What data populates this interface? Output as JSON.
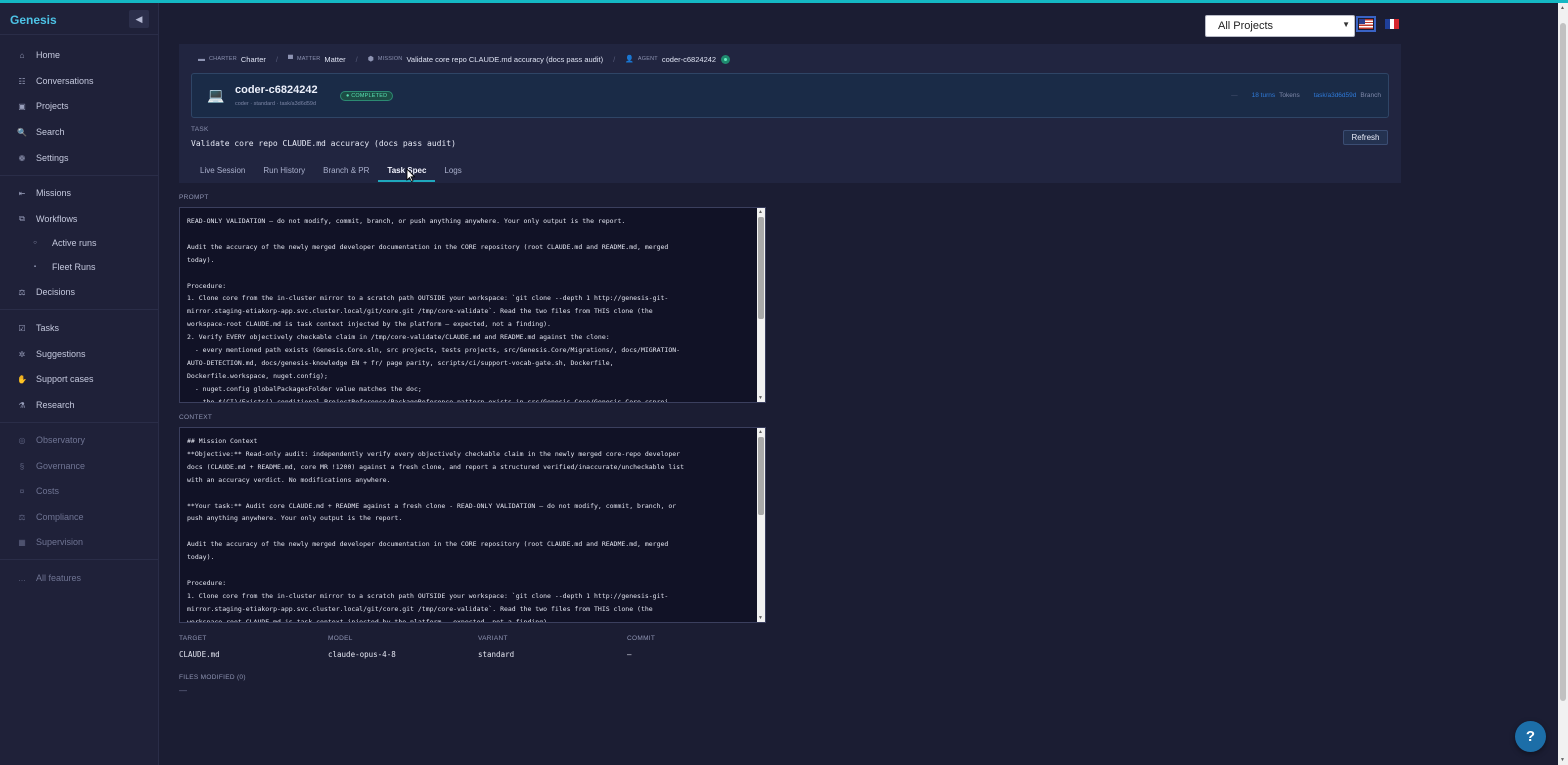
{
  "app": {
    "brand": "Genesis",
    "collapse_icon": "◀"
  },
  "sidebar": {
    "primary": [
      {
        "label": "Home",
        "icon": "⌂"
      },
      {
        "label": "Conversations",
        "icon": "☷"
      },
      {
        "label": "Projects",
        "icon": "▣"
      },
      {
        "label": "Search",
        "icon": "🔍"
      },
      {
        "label": "Settings",
        "icon": "❁"
      }
    ],
    "work": [
      {
        "label": "Missions",
        "icon": "⇤"
      },
      {
        "label": "Workflows",
        "icon": "⧉"
      },
      {
        "label": "Active runs",
        "icon": "○"
      },
      {
        "label": "Fleet Runs",
        "icon": "▪"
      },
      {
        "label": "Decisions",
        "icon": "⚖"
      }
    ],
    "ops": [
      {
        "label": "Tasks",
        "icon": "☑"
      },
      {
        "label": "Suggestions",
        "icon": "✲"
      },
      {
        "label": "Support cases",
        "icon": "✋"
      },
      {
        "label": "Research",
        "icon": "⚗"
      }
    ],
    "gov": [
      {
        "label": "Observatory",
        "icon": "◎"
      },
      {
        "label": "Governance",
        "icon": "§"
      },
      {
        "label": "Costs",
        "icon": "¤"
      },
      {
        "label": "Compliance",
        "icon": "⚖"
      },
      {
        "label": "Supervision",
        "icon": "▦"
      }
    ],
    "all_features": {
      "label": "All features",
      "icon": "…"
    }
  },
  "header": {
    "project_select": "All Projects",
    "flags": [
      "us-flag",
      "fr-flag"
    ],
    "fr_colors": [
      "#1f3f99",
      "#ffffff",
      "#d6262e"
    ]
  },
  "breadcrumb": [
    {
      "icon": "▬",
      "tag": "CHARTER",
      "value": "Charter"
    },
    {
      "icon": "▀",
      "tag": "MATTER",
      "value": "Matter"
    },
    {
      "icon": "⬢",
      "tag": "MISSION",
      "value": "Validate core repo CLAUDE.md accuracy (docs pass audit)"
    },
    {
      "icon": "👤",
      "tag": "AGENT",
      "value": "coder-c6824242"
    }
  ],
  "agent": {
    "icon": "💻",
    "name": "coder-c6824242",
    "subtitle": "coder · standard · task/a3d6d59d",
    "status": "● COMPLETED",
    "dash": "—",
    "turns": "18 turns",
    "tokens_label": "Tokens",
    "branch": "task/a3d6d59d",
    "branch_label": "Branch"
  },
  "task": {
    "label": "TASK",
    "title": "Validate core repo CLAUDE.md accuracy (docs pass audit)",
    "refresh": "Refresh"
  },
  "tabs": [
    {
      "label": "Live Session"
    },
    {
      "label": "Run History"
    },
    {
      "label": "Branch & PR"
    },
    {
      "label": "Task Spec"
    },
    {
      "label": "Logs"
    }
  ],
  "prompt": {
    "label": "PROMPT",
    "lines": [
      "READ-ONLY VALIDATION — do not modify, commit, branch, or push anything anywhere. Your only output is the report.",
      "",
      "Audit the accuracy of the newly merged developer documentation in the CORE repository (root CLAUDE.md and README.md, merged",
      "today).",
      "",
      "Procedure:",
      "1. Clone core from the in-cluster mirror to a scratch path OUTSIDE your workspace: `git clone --depth 1 http://genesis-git-",
      "mirror.staging-etiakorp-app.svc.cluster.local/git/core.git /tmp/core-validate`. Read the two files from THIS clone (the",
      "workspace-root CLAUDE.md is task context injected by the platform — expected, not a finding).",
      "2. Verify EVERY objectively checkable claim in /tmp/core-validate/CLAUDE.md and README.md against the clone:",
      "  - every mentioned path exists (Genesis.Core.sln, src projects, tests projects, src/Genesis.Core/Migrations/, docs/MIGRATION-",
      "AUTO-DETECTION.md, docs/genesis-knowledge EN + fr/ page parity, scripts/ci/support-vocab-gate.sh, Dockerfile,",
      "Dockerfile.workspace, nuget.config);",
      "  - nuget.config globalPackagesFolder value matches the doc;",
      "  - the $(CI)/Exists() conditional ProjectReference/PackageReference pattern exists in src/Genesis.Core/Genesis.Core.csproj"
    ]
  },
  "context": {
    "label": "CONTEXT",
    "lines": [
      "## Mission Context",
      "**Objective:** Read-only audit: independently verify every objectively checkable claim in the newly merged core-repo developer",
      "docs (CLAUDE.md + README.md, core MR !1200) against a fresh clone, and report a structured verified/inaccurate/uncheckable list",
      "with an accuracy verdict. No modifications anywhere.",
      "",
      "**Your task:** Audit core CLAUDE.md + README against a fresh clone - READ-ONLY VALIDATION — do not modify, commit, branch, or",
      "push anything anywhere. Your only output is the report.",
      "",
      "Audit the accuracy of the newly merged developer documentation in the CORE repository (root CLAUDE.md and README.md, merged",
      "today).",
      "",
      "Procedure:",
      "1. Clone core from the in-cluster mirror to a scratch path OUTSIDE your workspace: `git clone --depth 1 http://genesis-git-",
      "mirror.staging-etiakorp-app.svc.cluster.local/git/core.git /tmp/core-validate`. Read the two files from THIS clone (the",
      "workspace-root CLAUDE.md is task context injected by the platform — expected, not a finding)."
    ]
  },
  "meta": [
    {
      "key": "TARGET",
      "value": "CLAUDE.md"
    },
    {
      "key": "MODEL",
      "value": "claude-opus-4-8"
    },
    {
      "key": "VARIANT",
      "value": "standard"
    },
    {
      "key": "COMMIT",
      "value": "—"
    }
  ],
  "files_modified": {
    "label": "FILES MODIFIED (0)",
    "value": "—"
  },
  "help": {
    "label": "?"
  },
  "colors": {
    "accent": "#1fa8bd",
    "status_green": "#59e0b2",
    "link_blue": "#2f7ad8"
  }
}
